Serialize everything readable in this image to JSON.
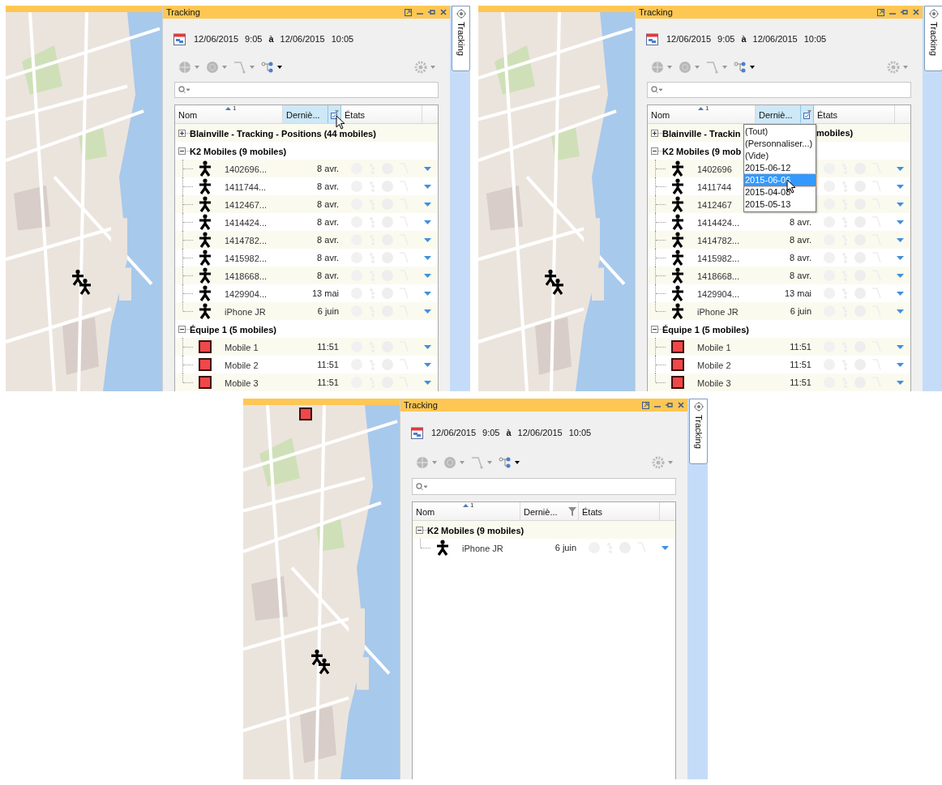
{
  "panes": [
    {
      "panel": {
        "title": "Tracking",
        "range": {
          "date_from": "12/06/2015",
          "time_from": "9:05",
          "separator": "à",
          "date_to": "12/06/2015",
          "time_to": "10:05"
        },
        "toolbar": [
          {
            "kind": "globe",
            "disabled": true
          },
          {
            "kind": "circle",
            "disabled": true
          },
          {
            "kind": "route",
            "disabled": true
          },
          {
            "kind": "nodes",
            "disabled": false
          },
          {
            "kind": "gear",
            "disabled": true
          }
        ],
        "columns": [
          {
            "label": "Nom",
            "sort_rank": "1"
          },
          {
            "label": "Derniè...",
            "highlighted": true,
            "hovered": true
          },
          {
            "label": "États"
          }
        ],
        "groups": [
          {
            "label": "Blainville - Tracking - Positions (44 mobiles)",
            "expanded": false
          },
          {
            "label": "K2 Mobiles (9 mobiles)",
            "expanded": true,
            "children": [
              {
                "kind": "person",
                "name": "1402696...",
                "date": "8 avr."
              },
              {
                "kind": "person",
                "name": "1411744...",
                "date": "8 avr."
              },
              {
                "kind": "person",
                "name": "1412467...",
                "date": "8 avr."
              },
              {
                "kind": "person",
                "name": "1414424...",
                "date": "8 avr."
              },
              {
                "kind": "person",
                "name": "1414782...",
                "date": "8 avr."
              },
              {
                "kind": "person",
                "name": "1415982...",
                "date": "8 avr."
              },
              {
                "kind": "person",
                "name": "1418668...",
                "date": "8 avr."
              },
              {
                "kind": "person",
                "name": "1429904...",
                "date": "13 mai"
              },
              {
                "kind": "person",
                "name": "iPhone JR",
                "date": "6 juin"
              }
            ]
          },
          {
            "label": "Équipe 1 (5 mobiles)",
            "expanded": true,
            "children": [
              {
                "kind": "square",
                "name": "Mobile 1",
                "date": "11:51"
              },
              {
                "kind": "square",
                "name": "Mobile 2",
                "date": "11:51"
              },
              {
                "kind": "square",
                "name": "Mobile 3",
                "date": "11:51"
              }
            ]
          }
        ],
        "side_tab": "Tracking"
      }
    },
    {
      "panel": {
        "title": "Tracking",
        "range": {
          "date_from": "12/06/2015",
          "time_from": "9:05",
          "separator": "à",
          "date_to": "12/06/2015",
          "time_to": "10:05"
        },
        "toolbar": [
          {
            "kind": "globe",
            "disabled": true
          },
          {
            "kind": "circle",
            "disabled": true
          },
          {
            "kind": "route",
            "disabled": true
          },
          {
            "kind": "nodes",
            "disabled": false
          },
          {
            "kind": "gear",
            "disabled": true
          }
        ],
        "columns": [
          {
            "label": "Nom",
            "sort_rank": "1"
          },
          {
            "label": "Derniè...",
            "highlighted": true,
            "hovered": false
          },
          {
            "label": "États"
          }
        ],
        "filter_menu": [
          {
            "label": "(Tout)",
            "selected": false
          },
          {
            "label": "(Personnaliser...)",
            "selected": false
          },
          {
            "label": "(Vide)",
            "selected": false
          },
          {
            "label": "2015-06-12",
            "selected": false
          },
          {
            "label": "2015-06-06",
            "selected": true
          },
          {
            "label": "2015-04-08",
            "selected": false
          },
          {
            "label": "2015-05-13",
            "selected": false
          }
        ],
        "groups": [
          {
            "label": "Blainville - Trackin",
            "label_tail": "mobiles)",
            "expanded": false
          },
          {
            "label": "K2 Mobiles (9 mob",
            "expanded": true,
            "children": [
              {
                "kind": "person",
                "name": "1402696"
              },
              {
                "kind": "person",
                "name": "1411744"
              },
              {
                "kind": "person",
                "name": "1412467"
              },
              {
                "kind": "person",
                "name": "1414424...",
                "date": "8 avr."
              },
              {
                "kind": "person",
                "name": "1414782...",
                "date": "8 avr."
              },
              {
                "kind": "person",
                "name": "1415982...",
                "date": "8 avr."
              },
              {
                "kind": "person",
                "name": "1418668...",
                "date": "8 avr."
              },
              {
                "kind": "person",
                "name": "1429904...",
                "date": "13 mai"
              },
              {
                "kind": "person",
                "name": "iPhone JR",
                "date": "6 juin"
              }
            ]
          },
          {
            "label": "Équipe 1 (5 mobiles)",
            "expanded": true,
            "children": [
              {
                "kind": "square",
                "name": "Mobile 1",
                "date": "11:51"
              },
              {
                "kind": "square",
                "name": "Mobile 2",
                "date": "11:51"
              },
              {
                "kind": "square",
                "name": "Mobile 3",
                "date": "11:51"
              }
            ]
          }
        ],
        "side_tab": "Tracking"
      }
    },
    {
      "panel": {
        "title": "Tracking",
        "range": {
          "date_from": "12/06/2015",
          "time_from": "9:05",
          "separator": "à",
          "date_to": "12/06/2015",
          "time_to": "10:05"
        },
        "toolbar": [
          {
            "kind": "globe",
            "disabled": true
          },
          {
            "kind": "circle",
            "disabled": true
          },
          {
            "kind": "route",
            "disabled": true
          },
          {
            "kind": "nodes",
            "disabled": false
          },
          {
            "kind": "gear",
            "disabled": true
          }
        ],
        "columns": [
          {
            "label": "Nom",
            "sort_rank": "1"
          },
          {
            "label": "Derniè...",
            "highlighted": false,
            "hovered": false
          },
          {
            "label": "États"
          }
        ],
        "groups": [
          {
            "label": "K2 Mobiles (9 mobiles)",
            "expanded": true,
            "children": [
              {
                "kind": "person",
                "name": "iPhone JR",
                "date": "6 juin"
              }
            ]
          }
        ],
        "side_tab": "Tracking"
      }
    }
  ]
}
